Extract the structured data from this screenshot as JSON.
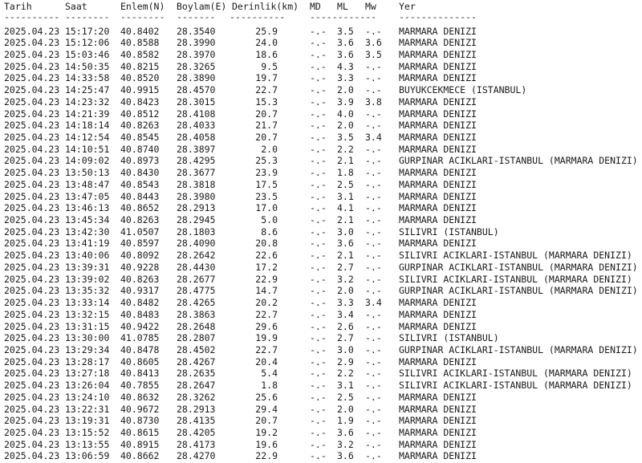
{
  "headers": {
    "date": "Tarih",
    "time": "Saat",
    "lat": "Enlem(N)",
    "lon": "Boylam(E)",
    "depth": "Derinlik(km)",
    "md": "MD",
    "ml": "ML",
    "mw": "Mw",
    "loc": "Yer"
  },
  "separators": {
    "date": "----------",
    "time": "--------",
    "lat": "--------",
    "lon": "-------",
    "depth": "----------",
    "mag": "------------",
    "loc": "--------------"
  },
  "rows": [
    {
      "date": "2025.04.23",
      "time": "15:17:20",
      "lat": "40.8402",
      "lon": "28.3540",
      "depth": "25.9",
      "md": "-.-",
      "ml": "3.5",
      "mw": "-.-",
      "loc": "MARMARA DENIZI"
    },
    {
      "date": "2025.04.23",
      "time": "15:12:06",
      "lat": "40.8588",
      "lon": "28.3990",
      "depth": "24.0",
      "md": "-.-",
      "ml": "3.6",
      "mw": "3.6",
      "loc": "MARMARA DENIZI"
    },
    {
      "date": "2025.04.23",
      "time": "15:03:46",
      "lat": "40.8582",
      "lon": "28.3970",
      "depth": "18.6",
      "md": "-.-",
      "ml": "3.6",
      "mw": "3.5",
      "loc": "MARMARA DENIZI"
    },
    {
      "date": "2025.04.23",
      "time": "14:50:35",
      "lat": "40.8215",
      "lon": "28.3265",
      "depth": "9.5",
      "md": "-.-",
      "ml": "4.3",
      "mw": "-.-",
      "loc": "MARMARA DENIZI"
    },
    {
      "date": "2025.04.23",
      "time": "14:33:58",
      "lat": "40.8520",
      "lon": "28.3890",
      "depth": "19.7",
      "md": "-.-",
      "ml": "3.3",
      "mw": "-.-",
      "loc": "MARMARA DENIZI"
    },
    {
      "date": "2025.04.23",
      "time": "14:25:47",
      "lat": "40.9915",
      "lon": "28.4570",
      "depth": "22.7",
      "md": "-.-",
      "ml": "2.0",
      "mw": "-.-",
      "loc": "BUYUKCEKMECE (ISTANBUL)"
    },
    {
      "date": "2025.04.23",
      "time": "14:23:32",
      "lat": "40.8423",
      "lon": "28.3015",
      "depth": "15.3",
      "md": "-.-",
      "ml": "3.9",
      "mw": "3.8",
      "loc": "MARMARA DENIZI"
    },
    {
      "date": "2025.04.23",
      "time": "14:21:39",
      "lat": "40.8512",
      "lon": "28.4108",
      "depth": "20.7",
      "md": "-.-",
      "ml": "4.0",
      "mw": "-.-",
      "loc": "MARMARA DENIZI"
    },
    {
      "date": "2025.04.23",
      "time": "14:18:14",
      "lat": "40.8263",
      "lon": "28.4033",
      "depth": "21.7",
      "md": "-.-",
      "ml": "2.0",
      "mw": "-.-",
      "loc": "MARMARA DENIZI"
    },
    {
      "date": "2025.04.23",
      "time": "14:12:54",
      "lat": "40.8545",
      "lon": "28.4058",
      "depth": "20.7",
      "md": "-.-",
      "ml": "3.5",
      "mw": "3.4",
      "loc": "MARMARA DENIZI"
    },
    {
      "date": "2025.04.23",
      "time": "14:10:51",
      "lat": "40.8740",
      "lon": "28.3897",
      "depth": "2.0",
      "md": "-.-",
      "ml": "2.2",
      "mw": "-.-",
      "loc": "MARMARA DENIZI"
    },
    {
      "date": "2025.04.23",
      "time": "14:09:02",
      "lat": "40.8973",
      "lon": "28.4295",
      "depth": "25.3",
      "md": "-.-",
      "ml": "2.1",
      "mw": "-.-",
      "loc": "GURPINAR ACIKLARI-ISTANBUL (MARMARA DENIZI)"
    },
    {
      "date": "2025.04.23",
      "time": "13:50:13",
      "lat": "40.8430",
      "lon": "28.3677",
      "depth": "23.9",
      "md": "-.-",
      "ml": "1.8",
      "mw": "-.-",
      "loc": "MARMARA DENIZI"
    },
    {
      "date": "2025.04.23",
      "time": "13:48:47",
      "lat": "40.8543",
      "lon": "28.3818",
      "depth": "17.5",
      "md": "-.-",
      "ml": "2.5",
      "mw": "-.-",
      "loc": "MARMARA DENIZI"
    },
    {
      "date": "2025.04.23",
      "time": "13:47:05",
      "lat": "40.8443",
      "lon": "28.3980",
      "depth": "23.5",
      "md": "-.-",
      "ml": "3.1",
      "mw": "-.-",
      "loc": "MARMARA DENIZI"
    },
    {
      "date": "2025.04.23",
      "time": "13:46:13",
      "lat": "40.8652",
      "lon": "28.2913",
      "depth": "17.0",
      "md": "-.-",
      "ml": "4.1",
      "mw": "-.-",
      "loc": "MARMARA DENIZI"
    },
    {
      "date": "2025.04.23",
      "time": "13:45:34",
      "lat": "40.8263",
      "lon": "28.2945",
      "depth": "5.0",
      "md": "-.-",
      "ml": "2.1",
      "mw": "-.-",
      "loc": "MARMARA DENIZI"
    },
    {
      "date": "2025.04.23",
      "time": "13:42:30",
      "lat": "41.0507",
      "lon": "28.1803",
      "depth": "8.6",
      "md": "-.-",
      "ml": "3.0",
      "mw": "-.-",
      "loc": "SILIVRI (ISTANBUL)"
    },
    {
      "date": "2025.04.23",
      "time": "13:41:19",
      "lat": "40.8597",
      "lon": "28.4090",
      "depth": "20.8",
      "md": "-.-",
      "ml": "3.6",
      "mw": "-.-",
      "loc": "MARMARA DENIZI"
    },
    {
      "date": "2025.04.23",
      "time": "13:40:06",
      "lat": "40.8092",
      "lon": "28.2642",
      "depth": "22.6",
      "md": "-.-",
      "ml": "2.1",
      "mw": "-.-",
      "loc": "SILIVRI ACIKLARI-ISTANBUL (MARMARA DENIZI)"
    },
    {
      "date": "2025.04.23",
      "time": "13:39:31",
      "lat": "40.9228",
      "lon": "28.4430",
      "depth": "17.2",
      "md": "-.-",
      "ml": "2.7",
      "mw": "-.-",
      "loc": "GURPINAR ACIKLARI-ISTANBUL (MARMARA DENIZI)"
    },
    {
      "date": "2025.04.23",
      "time": "13:39:02",
      "lat": "40.8263",
      "lon": "28.2677",
      "depth": "22.9",
      "md": "-.-",
      "ml": "3.2",
      "mw": "-.-",
      "loc": "SILIVRI ACIKLARI-ISTANBUL (MARMARA DENIZI)"
    },
    {
      "date": "2025.04.23",
      "time": "13:35:32",
      "lat": "40.9317",
      "lon": "28.4775",
      "depth": "14.7",
      "md": "-.-",
      "ml": "2.0",
      "mw": "-.-",
      "loc": "GURPINAR ACIKLARI-ISTANBUL (MARMARA DENIZI)"
    },
    {
      "date": "2025.04.23",
      "time": "13:33:14",
      "lat": "40.8482",
      "lon": "28.4265",
      "depth": "20.2",
      "md": "-.-",
      "ml": "3.3",
      "mw": "3.4",
      "loc": "MARMARA DENIZI"
    },
    {
      "date": "2025.04.23",
      "time": "13:32:15",
      "lat": "40.8483",
      "lon": "28.3863",
      "depth": "22.7",
      "md": "-.-",
      "ml": "3.4",
      "mw": "-.-",
      "loc": "MARMARA DENIZI"
    },
    {
      "date": "2025.04.23",
      "time": "13:31:15",
      "lat": "40.9422",
      "lon": "28.2648",
      "depth": "29.6",
      "md": "-.-",
      "ml": "2.6",
      "mw": "-.-",
      "loc": "MARMARA DENIZI"
    },
    {
      "date": "2025.04.23",
      "time": "13:30:00",
      "lat": "41.0785",
      "lon": "28.2807",
      "depth": "19.9",
      "md": "-.-",
      "ml": "2.7",
      "mw": "-.-",
      "loc": "SILIVRI (ISTANBUL)"
    },
    {
      "date": "2025.04.23",
      "time": "13:29:34",
      "lat": "40.8478",
      "lon": "28.4502",
      "depth": "22.7",
      "md": "-.-",
      "ml": "3.0",
      "mw": "-.-",
      "loc": "GURPINAR ACIKLARI-ISTANBUL (MARMARA DENIZI)"
    },
    {
      "date": "2025.04.23",
      "time": "13:28:17",
      "lat": "40.8605",
      "lon": "28.4267",
      "depth": "20.4",
      "md": "-.-",
      "ml": "2.9",
      "mw": "-.-",
      "loc": "MARMARA DENIZI"
    },
    {
      "date": "2025.04.23",
      "time": "13:27:18",
      "lat": "40.8413",
      "lon": "28.2635",
      "depth": "5.4",
      "md": "-.-",
      "ml": "2.2",
      "mw": "-.-",
      "loc": "SILIVRI ACIKLARI-ISTANBUL (MARMARA DENIZI)"
    },
    {
      "date": "2025.04.23",
      "time": "13:26:04",
      "lat": "40.7855",
      "lon": "28.2647",
      "depth": "1.8",
      "md": "-.-",
      "ml": "3.1",
      "mw": "-.-",
      "loc": "SILIVRI ACIKLARI-ISTANBUL (MARMARA DENIZI)"
    },
    {
      "date": "2025.04.23",
      "time": "13:24:10",
      "lat": "40.8632",
      "lon": "28.3262",
      "depth": "25.6",
      "md": "-.-",
      "ml": "2.5",
      "mw": "-.-",
      "loc": "MARMARA DENIZI"
    },
    {
      "date": "2025.04.23",
      "time": "13:22:31",
      "lat": "40.9672",
      "lon": "28.2913",
      "depth": "29.4",
      "md": "-.-",
      "ml": "2.0",
      "mw": "-.-",
      "loc": "MARMARA DENIZI"
    },
    {
      "date": "2025.04.23",
      "time": "13:19:31",
      "lat": "40.8730",
      "lon": "28.4135",
      "depth": "20.7",
      "md": "-.-",
      "ml": "1.9",
      "mw": "-.-",
      "loc": "MARMARA DENIZI"
    },
    {
      "date": "2025.04.23",
      "time": "13:15:52",
      "lat": "40.8615",
      "lon": "28.4205",
      "depth": "19.2",
      "md": "-.-",
      "ml": "3.6",
      "mw": "-.-",
      "loc": "MARMARA DENIZI"
    },
    {
      "date": "2025.04.23",
      "time": "13:13:55",
      "lat": "40.8915",
      "lon": "28.4173",
      "depth": "19.6",
      "md": "-.-",
      "ml": "3.2",
      "mw": "-.-",
      "loc": "MARMARA DENIZI"
    },
    {
      "date": "2025.04.23",
      "time": "13:06:59",
      "lat": "40.8662",
      "lon": "28.4270",
      "depth": "22.9",
      "md": "-.-",
      "ml": "3.6",
      "mw": "-.-",
      "loc": "MARMARA DENIZI"
    }
  ]
}
